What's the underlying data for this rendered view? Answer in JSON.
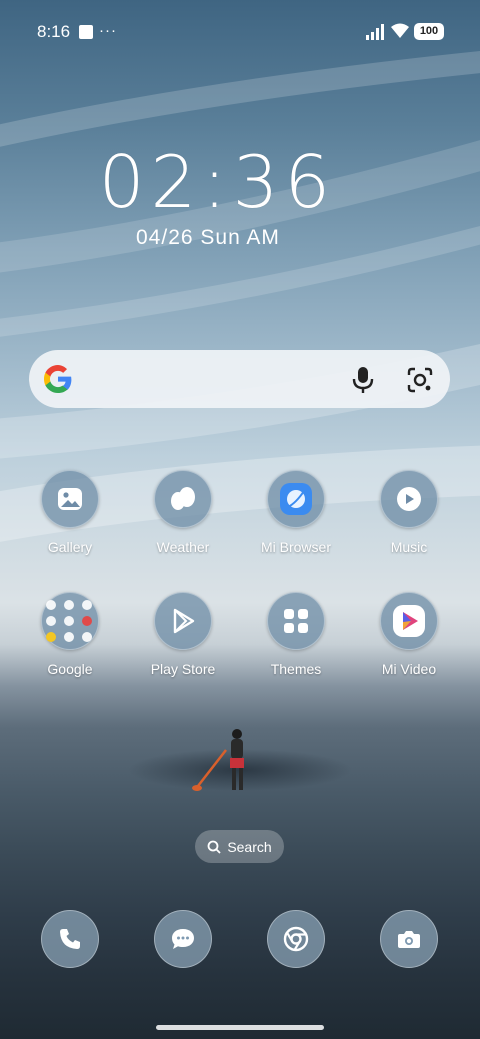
{
  "status": {
    "time": "8:16",
    "more": "···",
    "battery": "100"
  },
  "lockscreen": {
    "clock": "02:36",
    "date": "04/26 Sun AM"
  },
  "apps": [
    {
      "label": "Gallery",
      "icon": "gallery-icon"
    },
    {
      "label": "Weather",
      "icon": "weather-icon"
    },
    {
      "label": "Mi Browser",
      "icon": "browser-icon"
    },
    {
      "label": "Music",
      "icon": "music-icon"
    },
    {
      "label": "Google",
      "icon": "folder-icon"
    },
    {
      "label": "Play Store",
      "icon": "play-store-icon"
    },
    {
      "label": "Themes",
      "icon": "themes-icon"
    },
    {
      "label": "Mi Video",
      "icon": "mi-video-icon"
    }
  ],
  "search_pill": {
    "label": "Search"
  },
  "dock": [
    {
      "icon": "phone-icon"
    },
    {
      "icon": "messages-icon"
    },
    {
      "icon": "chrome-icon"
    },
    {
      "icon": "camera-icon"
    }
  ],
  "colors": {
    "accent_blue": "#3b8bf0",
    "google_blue": "#4285f4",
    "google_red": "#ea4335",
    "google_yellow": "#fbbc05",
    "google_green": "#34a853"
  }
}
